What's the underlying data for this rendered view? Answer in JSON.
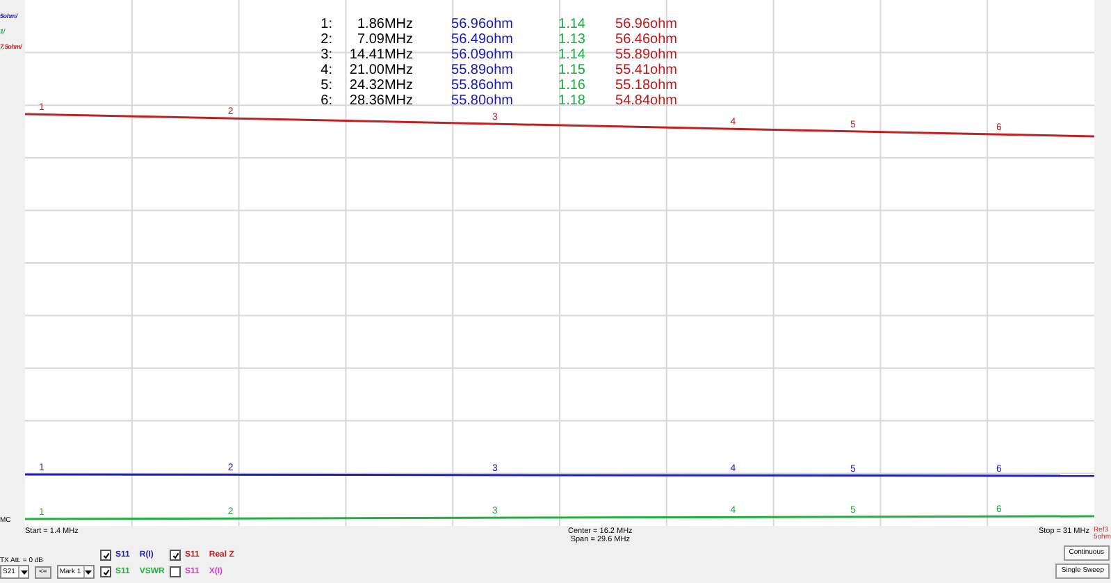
{
  "scale_labels": [
    {
      "text": "5ohm/",
      "color": "#2020c0"
    },
    {
      "text": "1/",
      "color": "#20b040"
    },
    {
      "text": "7.5ohm/",
      "color": "#c02020"
    }
  ],
  "markers": [
    {
      "index": "1:",
      "freq": "1.86MHz",
      "r": "56.96ohm",
      "swr": "1.14",
      "real_z": "56.96ohm"
    },
    {
      "index": "2:",
      "freq": "7.09MHz",
      "r": "56.49ohm",
      "swr": "1.13",
      "real_z": "56.46ohm"
    },
    {
      "index": "3:",
      "freq": "14.41MHz",
      "r": "56.09ohm",
      "swr": "1.14",
      "real_z": "55.89ohm"
    },
    {
      "index": "4:",
      "freq": "21.00MHz",
      "r": "55.89ohm",
      "swr": "1.15",
      "real_z": "55.41ohm"
    },
    {
      "index": "5:",
      "freq": "24.32MHz",
      "r": "55.86ohm",
      "swr": "1.16",
      "real_z": "55.18ohm"
    },
    {
      "index": "6:",
      "freq": "28.36MHz",
      "r": "55.80ohm",
      "swr": "1.18",
      "real_z": "54.84ohm"
    }
  ],
  "trace_marker_labels": [
    [
      "1",
      "2",
      "3",
      "4",
      "5",
      "6"
    ],
    [
      "1",
      "2",
      "3",
      "4",
      "5",
      "6"
    ],
    [
      "1",
      "2",
      "3",
      "4",
      "5",
      "6"
    ]
  ],
  "mode_label": "MC",
  "ref_label": [
    "Ref3",
    "5ohm"
  ],
  "start": "Start = 1.4 MHz",
  "center": "Center = 16.2 MHz",
  "span": "Span = 29.6 MHz",
  "stop": "Stop = 31 MHz",
  "tx_att": "TX Att. = 0 dB",
  "port_select": "S21",
  "arrow_button": "<=",
  "marker_select": "Mark 1",
  "traces": [
    {
      "param": "S11",
      "name": "R(I)",
      "color": "#2020c0",
      "checked": true
    },
    {
      "param": "S11",
      "name": "VSWR",
      "color": "#20b040",
      "checked": true
    },
    {
      "param": "S11",
      "name": "Real Z",
      "color": "#c02020",
      "checked": true
    },
    {
      "param": "S11",
      "name": "X(I)",
      "color": "#d040c0",
      "checked": false
    }
  ],
  "buttons": [
    "Continuous",
    "Single Sweep"
  ]
}
